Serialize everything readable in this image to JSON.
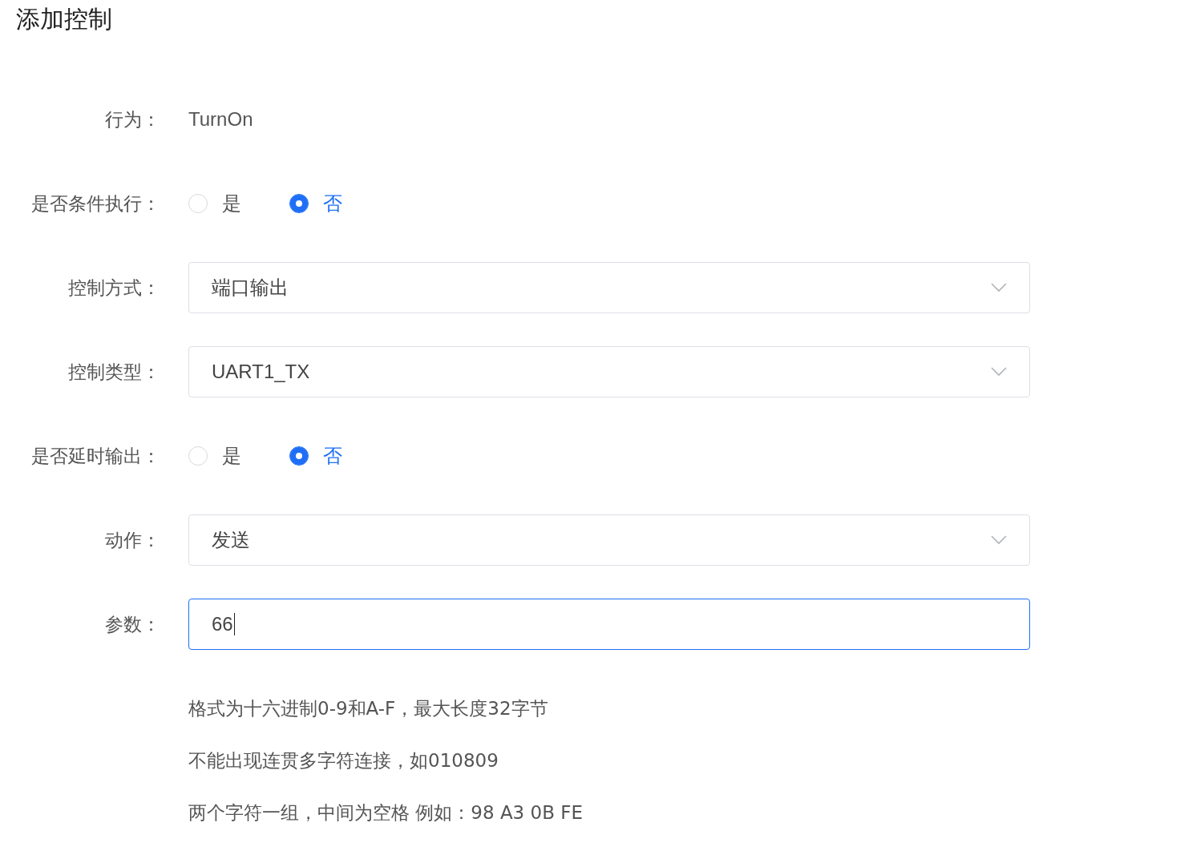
{
  "title": "添加控制",
  "fields": [
    {
      "kind": "text",
      "label": "行为：",
      "value": "TurnOn"
    },
    {
      "kind": "radio",
      "label": "是否条件执行：",
      "options": [
        {
          "label": "是",
          "selected": false
        },
        {
          "label": "否",
          "selected": true
        }
      ]
    },
    {
      "kind": "select",
      "label": "控制方式：",
      "value": "端口输出"
    },
    {
      "kind": "select",
      "label": "控制类型：",
      "value": "UART1_TX"
    },
    {
      "kind": "radio",
      "label": "是否延时输出：",
      "options": [
        {
          "label": "是",
          "selected": false
        },
        {
          "label": "否",
          "selected": true
        }
      ]
    },
    {
      "kind": "select",
      "label": "动作：",
      "value": "发送"
    },
    {
      "kind": "input",
      "label": "参数：",
      "value": "66",
      "focused": true
    }
  ],
  "hints": [
    "格式为十六进制0-9和A-F，最大长度32字节",
    "不能出现连贯多字符连接，如010809",
    "两个字符一组，中间为空格 例如：98 A3 0B FE"
  ]
}
